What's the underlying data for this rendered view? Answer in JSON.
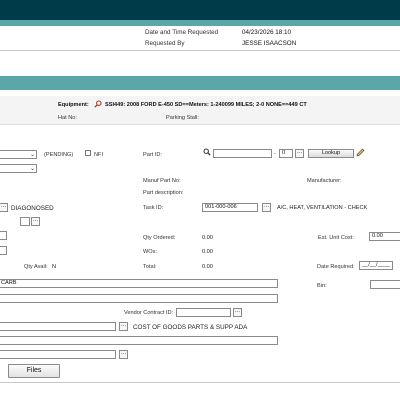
{
  "header": {
    "date_label": "Date and Time Requested",
    "date_value": "04/23/2026 18:10",
    "requested_by_label": "Requested By",
    "requested_by_value": "JESSE ISAACSON"
  },
  "equipment": {
    "label": "Equipment:",
    "value": "SSI449: 2008 FORD E-450 SD==Meters: 1-240099 MILES; 2-0 NONE==449 CT",
    "hat_no_label": "Hat No:",
    "parking_stall_label": "Parking Stall:"
  },
  "left": {
    "status_text": "(PENDING)",
    "nfi_label": "NFI",
    "diagnosed_text": "DIAGONOSED",
    "qty_avail_label": "Qty Avail:",
    "qty_avail_value": "N",
    "carb_text": "CARB",
    "cogs_text": "COST OF GOODS PARTS & SUPP ADA"
  },
  "middle": {
    "part_id_label": "Part ID:",
    "part_id_suffix_value": "0",
    "lookup_label": "Lookup",
    "manuf_part_label": "Manuf Part No:",
    "part_desc_label": "Part description:",
    "task_id_label": "Task ID:",
    "task_id_value": "001-000-006",
    "task_desc": "A/C, HEAT, VENTILATION - CHECK",
    "qty_ordered_label": "Qty Ordered:",
    "qty_ordered_value": "0.00",
    "wos_label": "WOs:",
    "wos_value": "0.00",
    "total_label": "Total:",
    "total_value": "0.00",
    "vendor_contract_label": "Vendor Contract ID:"
  },
  "right": {
    "manufacturer_label": "Manufacturer:",
    "unit_cost_label": "Est. Unit Cost:",
    "unit_cost_value": "0.00",
    "date_required_label": "Date Required:",
    "date_required_value": "__/__/____",
    "bin_label": "Bin:"
  },
  "footer": {
    "files_label": "Files"
  },
  "icons": {
    "equipment": "magnifier-icon",
    "part_search": "search-icon",
    "edit": "pencil-icon"
  },
  "colors": {
    "top_bar": "#003b4a",
    "teal_band": "#5aa6a8",
    "icon_red": "#b03a2e"
  }
}
